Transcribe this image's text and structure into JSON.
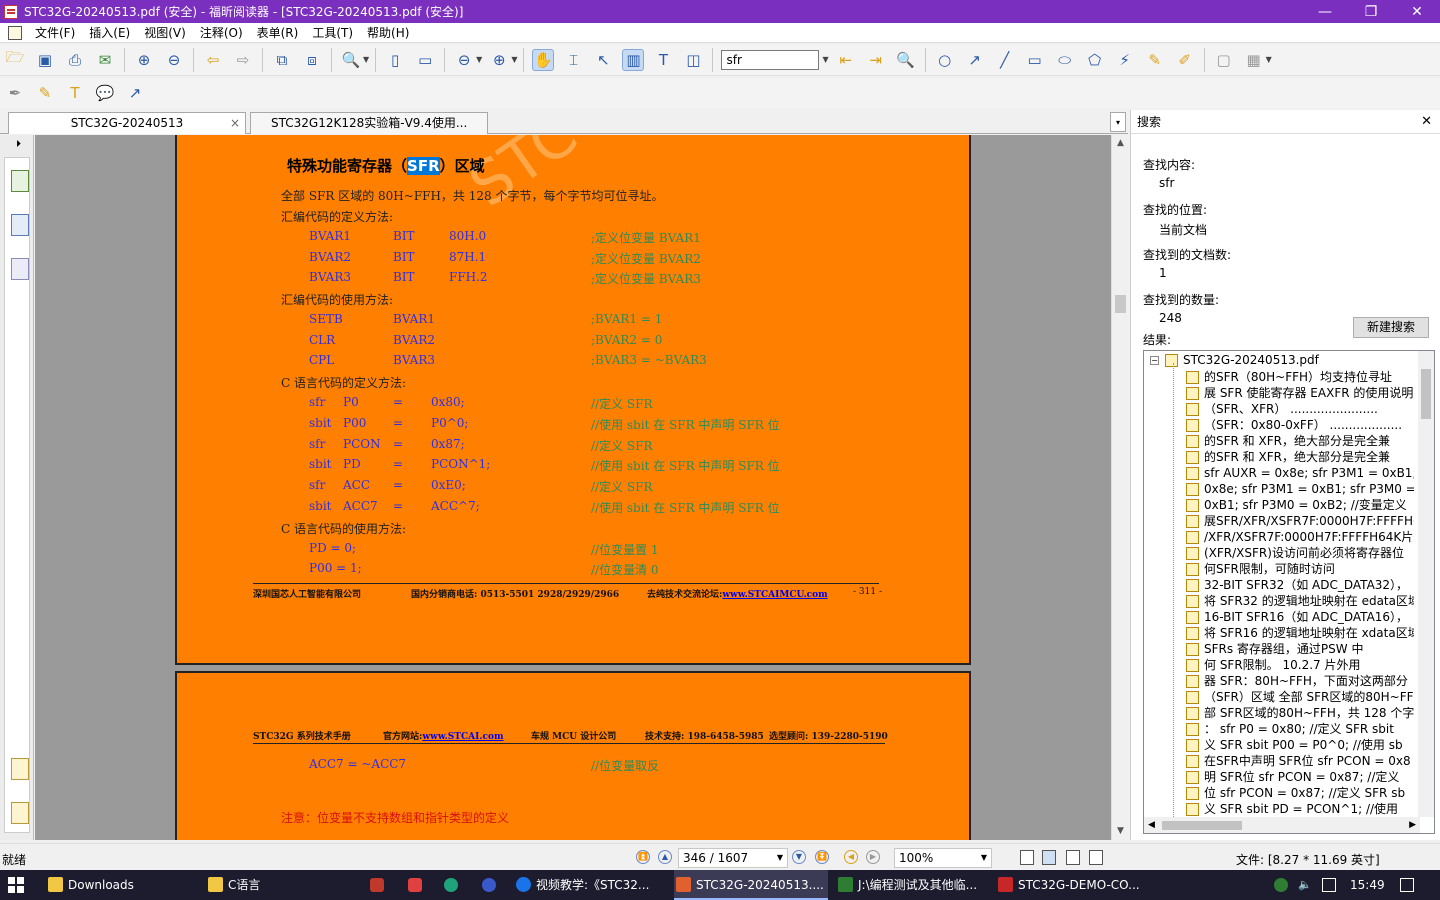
{
  "window": {
    "title": "STC32G-20240513.pdf (安全) - 福昕阅读器 - [STC32G-20240513.pdf (安全)]",
    "minimize": "—",
    "maximize": "❐",
    "close": "✕"
  },
  "menu": [
    "文件(F)",
    "插入(E)",
    "视图(V)",
    "注释(O)",
    "表单(R)",
    "工具(T)",
    "帮助(H)"
  ],
  "toolbar": {
    "search_value": "sfr"
  },
  "tabs": [
    {
      "label": "STC32G-20240513",
      "close": "×"
    },
    {
      "label": "STC32G12K128实验箱-V9.4使用..."
    }
  ],
  "tab_dropdown": "▾",
  "document": {
    "watermark": "STC",
    "heading_pre": "特殊功能寄存器（",
    "heading_hl": "SFR",
    "heading_post": "）区域",
    "intro": "全部 SFR 区域的 80H~FFH，共 128 个字节，每个字节均可位寻址。",
    "asm_def_title": "汇编代码的定义方法:",
    "asm_defs": [
      {
        "c1": "BVAR1",
        "c2": "BIT",
        "c3": "80H.0",
        "c4": ";定义位变量 BVAR1"
      },
      {
        "c1": "BVAR2",
        "c2": "BIT",
        "c3": "87H.1",
        "c4": ";定义位变量 BVAR2"
      },
      {
        "c1": "BVAR3",
        "c2": "BIT",
        "c3": "FFH.2",
        "c4": ";定义位变量 BVAR3"
      }
    ],
    "asm_use_title": "汇编代码的使用方法:",
    "asm_uses": [
      {
        "c1": "SETB",
        "c2": "BVAR1",
        "c3": ";BVAR1 = 1"
      },
      {
        "c1": "CLR",
        "c2": "BVAR2",
        "c3": ";BVAR2 = 0"
      },
      {
        "c1": "CPL",
        "c2": "BVAR3",
        "c3": ";BVAR3 = ~BVAR3"
      }
    ],
    "c_def_title": "C 语言代码的定义方法:",
    "c_defs": [
      {
        "c1": "sfr",
        "c2": "P0",
        "c3": "=",
        "c4": "0x80;",
        "c5": "//定义 SFR"
      },
      {
        "c1": "sbit",
        "c2": "P00",
        "c3": "=",
        "c4": "P0^0;",
        "c5": "//使用 sbit 在 SFR 中声明 SFR 位"
      },
      {
        "c1": "sfr",
        "c2": "PCON",
        "c3": "=",
        "c4": "0x87;",
        "c5": "//定义 SFR"
      },
      {
        "c1": "sbit",
        "c2": "PD",
        "c3": "=",
        "c4": "PCON^1;",
        "c5": "//使用 sbit 在 SFR 中声明 SFR 位"
      },
      {
        "c1": "sfr",
        "c2": "ACC",
        "c3": "=",
        "c4": "0xE0;",
        "c5": "//定义 SFR"
      },
      {
        "c1": "sbit",
        "c2": "ACC7",
        "c3": "=",
        "c4": "ACC^7;",
        "c5": "//使用 sbit 在 SFR 中声明 SFR 位"
      }
    ],
    "c_use_title": "C 语言代码的使用方法:",
    "c_uses": [
      {
        "c1": "PD = 0;",
        "c2": "//位变量置 1"
      },
      {
        "c1": "P00 = 1;",
        "c2": "//位变量清 0"
      }
    ],
    "footer1": {
      "company": "深圳国芯人工智能有限公司",
      "phone": "国内分销商电话: 0513-5501 2928/2929/2966",
      "forum_label": "去纯技术交流论坛:",
      "forum_link": "www.STCAIMCU.com",
      "page": "- 311 -"
    },
    "header2": {
      "manual": "STC32G 系列技术手册",
      "site_label": "官方网站:",
      "site_link": "www.STCAI.com",
      "company": "车规 MCU 设计公司",
      "support": "技术支持: 198-6458-5985",
      "consult": "选型顾问: 139-2280-5190"
    },
    "page2_line1_a": "ACC7 = ~ACC7",
    "page2_line1_b": "//位变量取反",
    "page2_note": "注意：位变量不支持数组和指针类型的定义"
  },
  "search_panel": {
    "title": "搜索",
    "close": "✕",
    "find_label": "查找内容:",
    "find_value": "sfr",
    "where_label": "查找的位置:",
    "where_value": "当前文档",
    "docs_label": "查找到的文档数:",
    "docs_value": "1",
    "count_label": "查找到的数量:",
    "count_value": "248",
    "new_search": "新建搜索",
    "results_label": "结果:",
    "root": "STC32G-20240513.pdf",
    "results": [
      "的SFR（80H~FFH）均支持位寻址",
      "展 SFR 使能寄存器 EAXFR 的使用说明",
      "（SFR、XFR） .......................",
      "（SFR：0x80-0xFF） ...................",
      "的SFR 和 XFR，绝大部分是完全兼",
      "的SFR 和 XFR，绝大部分是完全兼",
      "sfr  AUXR = 0x8e; sfr  P3M1 = 0xB1;",
      "0x8e; sfr  P3M1 = 0xB1; sfr  P3M0 =",
      "0xB1; sfr  P3M0 = 0xB2; //变量定义",
      "展SFR/XFR/XSFR7F:0000H7F:FFFFH64",
      "/XFR/XSFR7F:0000H7F:FFFFH64K片外",
      "(XFR/XSFR)设访问前必须将寄存器位",
      "何SFR限制，可随时访问",
      "32-BIT SFR32（如 ADC_DATA32），",
      "将 SFR32 的逻辑地址映射在 edata区域",
      "16-BIT SFR16（如 ADC_DATA16），",
      "将 SFR16 的逻辑地址映射在 xdata区域",
      "SFRs  寄存器组，通过PSW 中",
      "何 SFR限制。  10.2.7  片外用",
      "器 SFR：80H~FFH，下面对这两部分",
      "（SFR）区域 全部 SFR区域的80H~FFH",
      "部 SFR区域的80H~FFH，共 128 个字节",
      "：  sfr  P0  =  0x80;  //定义 SFR sbit",
      "义 SFR sbit  P00  =  P0^0;  //使用 sb",
      "在SFR中声明 SFR位 sfr  PCON  =  0x8",
      "明 SFR位 sfr  PCON  =  0x87;  //定义",
      "位 sfr  PCON  =  0x87;  //定义 SFR sb",
      "义 SFR sbit  PD  =  PCON^1;  //使用"
    ]
  },
  "status": {
    "ready": "就绪",
    "page": "346 / 1607",
    "zoom": "100%",
    "size": "文件: [8.27 * 11.69 英寸]"
  },
  "taskbar": {
    "items": [
      {
        "label": "Downloads",
        "color": "#f2c744"
      },
      {
        "label": "C语言",
        "color": "#f2c744"
      },
      {
        "label": "视频教学:《STC32...",
        "color": "#1a73e8"
      },
      {
        "label": "STC32G-20240513....",
        "color": "#e06030"
      },
      {
        "label": "J:\\编程测试及其他临...",
        "color": "#2e7d32"
      },
      {
        "label": "STC32G-DEMO-CO...",
        "color": "#c62828"
      }
    ],
    "time": "15:49"
  }
}
